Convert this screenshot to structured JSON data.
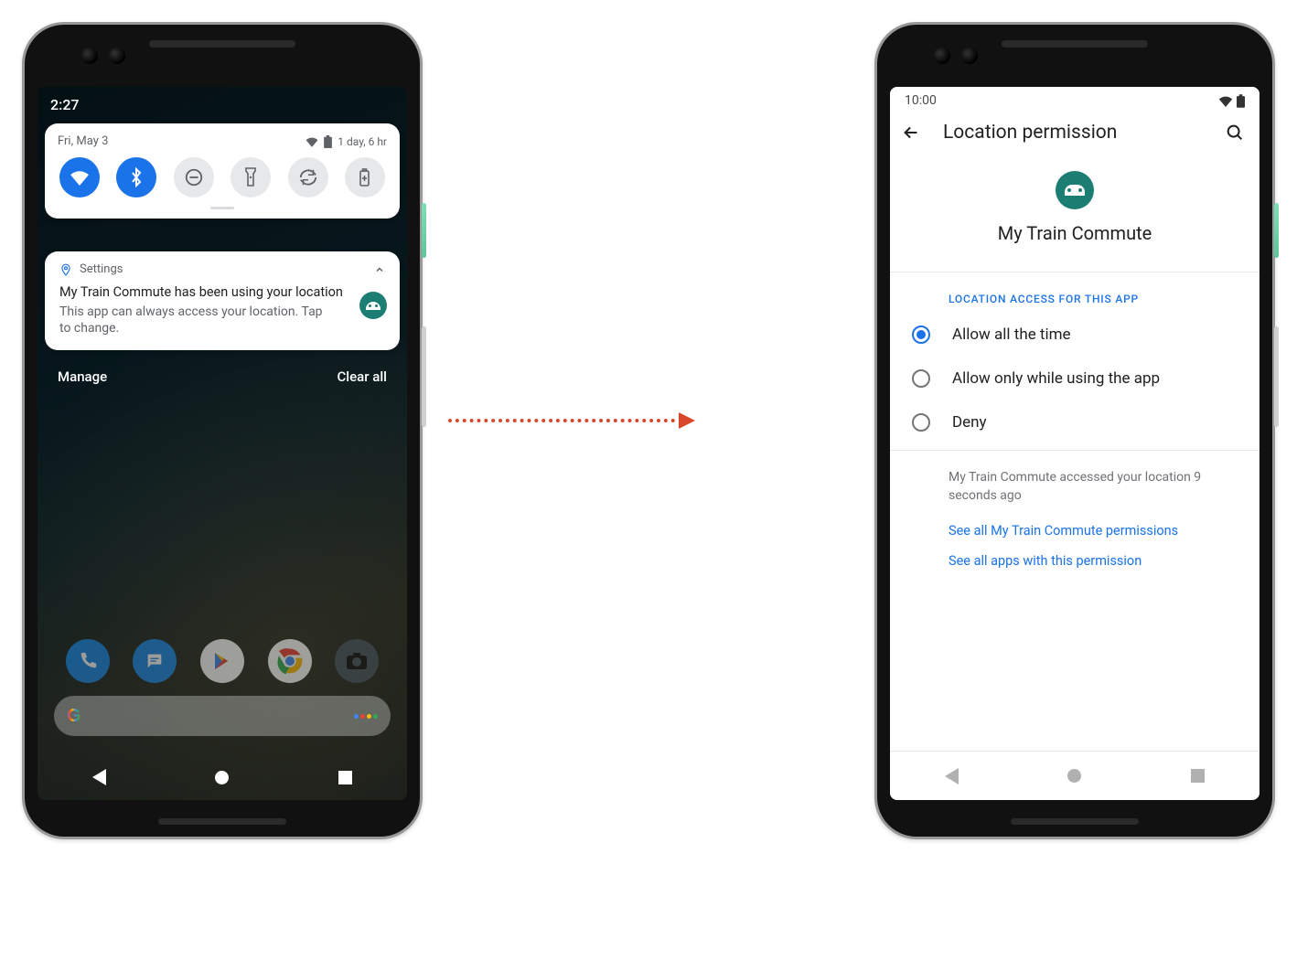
{
  "left": {
    "status_time": "2:27",
    "qs": {
      "date": "Fri, May 3",
      "battery_text": "1 day, 6 hr",
      "tiles": [
        {
          "name": "wifi",
          "active": true
        },
        {
          "name": "bluetooth",
          "active": true
        },
        {
          "name": "dnd",
          "active": false
        },
        {
          "name": "flashlight",
          "active": false
        },
        {
          "name": "autorotate",
          "active": false
        },
        {
          "name": "battery",
          "active": false
        }
      ]
    },
    "notification": {
      "app_label": "Settings",
      "title": "My Train Commute has been using your location",
      "body": "This app can always access your location. Tap to change."
    },
    "actions": {
      "manage": "Manage",
      "clear_all": "Clear all"
    }
  },
  "right": {
    "status_time": "10:00",
    "page_title": "Location permission",
    "app_name": "My Train Commute",
    "section_label": "LOCATION ACCESS FOR THIS APP",
    "options": [
      {
        "label": "Allow all the time",
        "selected": true
      },
      {
        "label": "Allow only while using the app",
        "selected": false
      },
      {
        "label": "Deny",
        "selected": false
      }
    ],
    "access_info": "My Train Commute accessed your location 9 seconds ago",
    "link_all_perms": "See all My Train Commute permissions",
    "link_all_apps": "See all apps with this permission"
  }
}
